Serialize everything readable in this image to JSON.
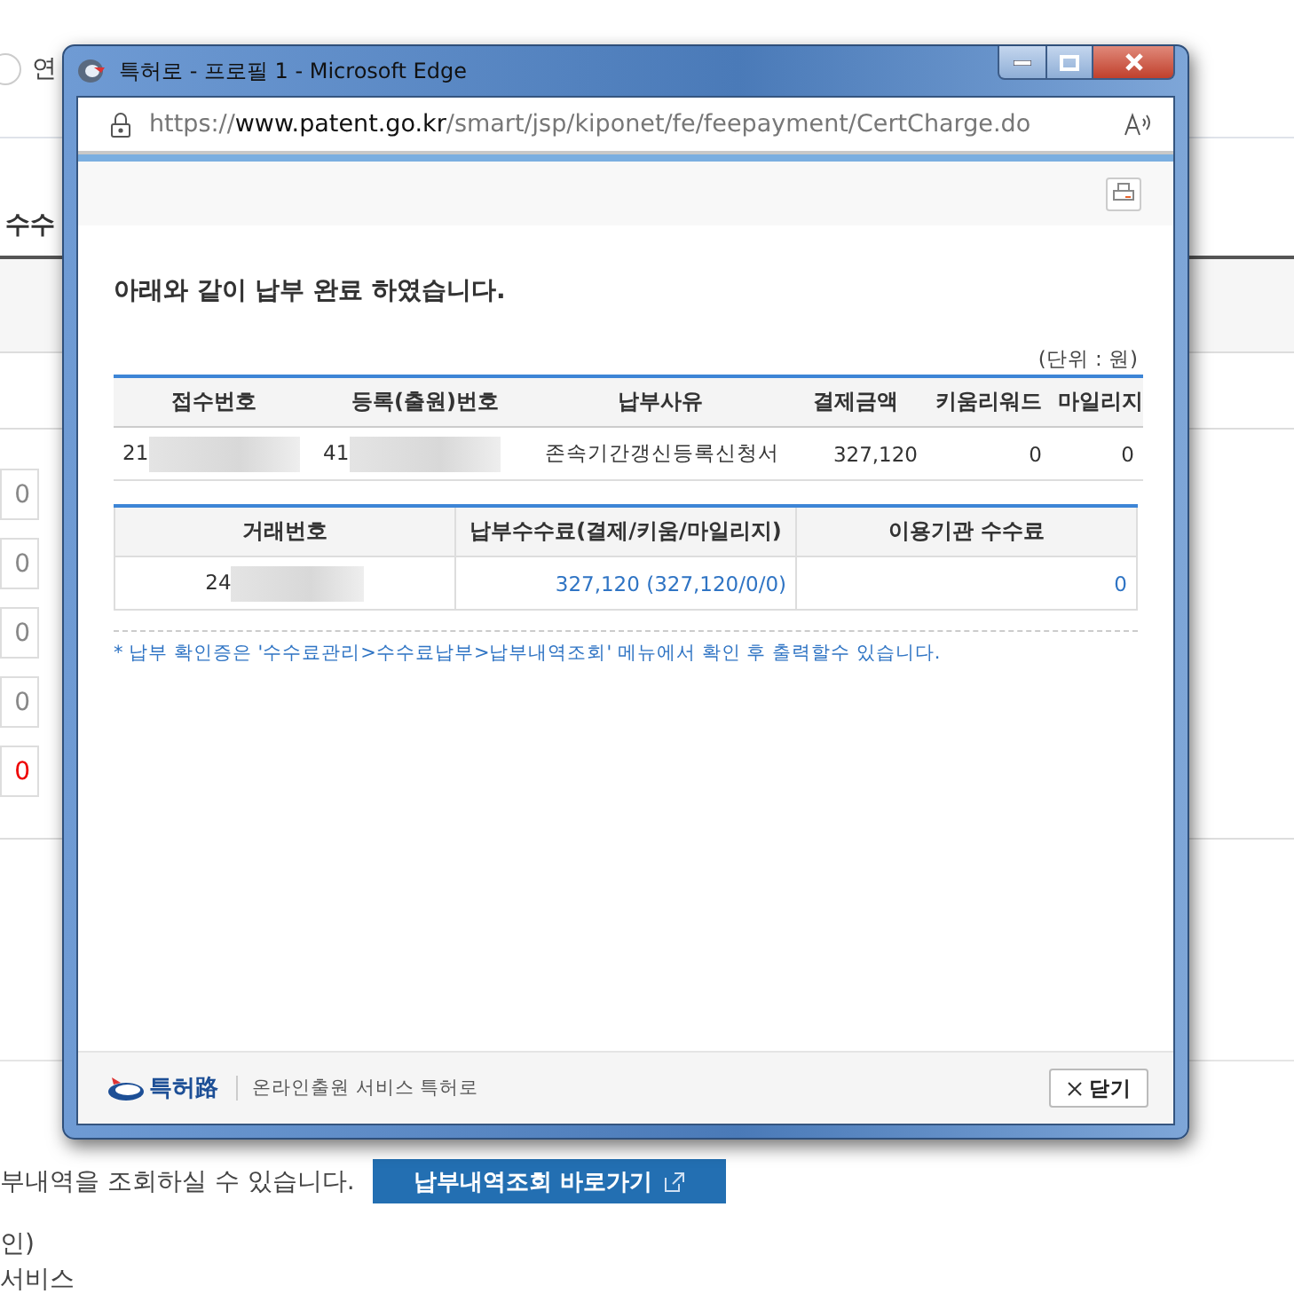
{
  "background_page": {
    "option_label": "연",
    "option_selected": false,
    "section_title": "수수",
    "fee_fields": [
      {
        "value": "0",
        "alert": false
      },
      {
        "value": "0",
        "alert": false
      },
      {
        "value": "0",
        "alert": false
      },
      {
        "value": "0",
        "alert": false
      },
      {
        "value": "0",
        "alert": true
      }
    ],
    "history_text": "부내역을 조회하실 수 있습니다.",
    "history_button": "납부내역조회 바로가기",
    "notes": [
      "인)",
      "서비스"
    ]
  },
  "popup": {
    "window": {
      "title": "특허로 - 프로필 1 - Microsoft Edge"
    },
    "address_bar": {
      "url": "https://**www.patent.go.kr**/smart/jsp/kiponet/fe/feepayment/CertCharge.do"
    },
    "heading": "아래와 같이 납부 완료 하였습니다.",
    "unit_note": "(단위 : 원)",
    "payment_table": {
      "columns": [
        "접수번호",
        "등록(출원)번호",
        "납부사유",
        "결제금액",
        "키움리워드",
        "마일리지"
      ],
      "rows": [
        {
          "cells": [
            {
              "text": "21",
              "redacted": true
            },
            {
              "text": "41",
              "redacted": true
            },
            {
              "text": "존속기간갱신등록신청서",
              "redacted": false
            },
            {
              "text": "327,120",
              "redacted": false
            },
            {
              "text": "0",
              "redacted": false
            },
            {
              "text": "0",
              "redacted": false
            }
          ]
        }
      ]
    },
    "fee_table": {
      "columns": [
        "거래번호",
        "납부수수료(결제/키움/마일리지)",
        "이용기관 수수료"
      ],
      "rows": [
        {
          "cells": [
            {
              "text": "24",
              "redacted": true
            },
            {
              "text": "327,120 (327,120/0/0)",
              "redacted": false
            },
            {
              "text": "0",
              "redacted": false
            }
          ]
        }
      ]
    },
    "note": "* 납부 확인증은 '수수료관리>수수료납부>납부내역조회' 메뉴에서 확인 후 출력할수 있습니다.",
    "footer": {
      "logo_text": "특허路",
      "service_text": "온라인출원 서비스 특허로",
      "close_button": "닫기"
    }
  }
}
